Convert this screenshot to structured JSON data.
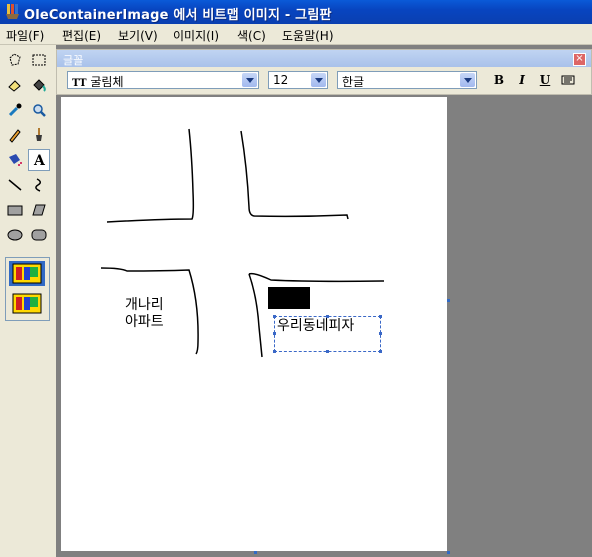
{
  "window": {
    "title": "OleContainerImage 에서 비트맵 이미지 - 그림판"
  },
  "menu": [
    "파일(F)",
    "편집(E)",
    "보기(V)",
    "이미지(I)",
    "색(C)",
    "도움말(H)"
  ],
  "tools": [
    "free-select-icon",
    "rect-select-icon",
    "eraser-icon",
    "fill-icon",
    "color-picker-icon",
    "magnifier-icon",
    "pencil-icon",
    "brush-icon",
    "airbrush-icon",
    "text-icon",
    "line-icon",
    "curve-icon",
    "rectangle-icon",
    "polygon-icon",
    "ellipse-icon",
    "rounded-rect-icon"
  ],
  "fontbar": {
    "title": "글꼴",
    "font": "굴림체",
    "size": "12",
    "script": "한글",
    "bold": "B",
    "italic": "I",
    "underline": "U"
  },
  "canvas": {
    "label_apartment": [
      "개나리",
      "아파트"
    ],
    "textbox_value": "우리동네피자"
  }
}
